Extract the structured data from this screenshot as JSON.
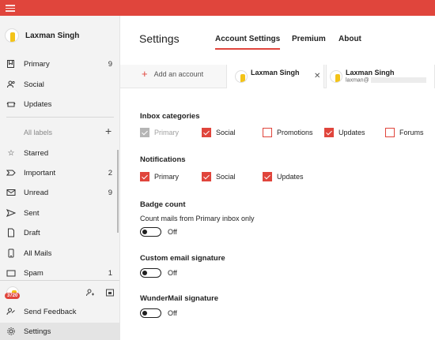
{
  "user": {
    "name": "Laxman Singh"
  },
  "sidebar": {
    "primary": [
      {
        "label": "Primary",
        "count": "9",
        "icon": "inbox-icon"
      },
      {
        "label": "Social",
        "count": "",
        "icon": "people-icon"
      },
      {
        "label": "Updates",
        "count": "",
        "icon": "updates-icon"
      }
    ],
    "all_labels": "All labels",
    "labels": [
      {
        "label": "Starred",
        "count": "",
        "icon": "star-icon"
      },
      {
        "label": "Important",
        "count": "2",
        "icon": "important-icon"
      },
      {
        "label": "Unread",
        "count": "9",
        "icon": "mail-icon"
      },
      {
        "label": "Sent",
        "count": "",
        "icon": "send-icon"
      },
      {
        "label": "Draft",
        "count": "",
        "icon": "draft-icon"
      },
      {
        "label": "All Mails",
        "count": "",
        "icon": "phone-icon"
      },
      {
        "label": "Spam",
        "count": "1",
        "icon": "spam-icon"
      }
    ],
    "badge": "3720",
    "send_feedback": "Send Feedback",
    "settings": "Settings"
  },
  "main": {
    "title": "Settings",
    "tabs": [
      "Account Settings",
      "Premium",
      "About"
    ],
    "active_tab": "Account Settings",
    "add_account": "Add an account",
    "accounts": [
      {
        "name": "Laxman Singh",
        "email": ""
      },
      {
        "name": "Laxman Singh",
        "email": "laxman@"
      }
    ],
    "inbox_categories": {
      "title": "Inbox categories",
      "items": [
        {
          "label": "Primary",
          "checked": true,
          "disabled": true
        },
        {
          "label": "Social",
          "checked": true,
          "disabled": false
        },
        {
          "label": "Promotions",
          "checked": false,
          "disabled": false
        },
        {
          "label": "Updates",
          "checked": true,
          "disabled": false
        },
        {
          "label": "Forums",
          "checked": false,
          "disabled": false
        }
      ]
    },
    "notifications": {
      "title": "Notifications",
      "items": [
        {
          "label": "Primary",
          "checked": true
        },
        {
          "label": "Social",
          "checked": true
        },
        {
          "label": "Updates",
          "checked": true
        }
      ]
    },
    "badge_count": {
      "title": "Badge count",
      "desc": "Count mails from Primary inbox only",
      "state": "Off"
    },
    "custom_signature": {
      "title": "Custom email signature",
      "state": "Off"
    },
    "wundermail_signature": {
      "title": "WunderMail signature",
      "state": "Off"
    }
  },
  "colors": {
    "accent": "#e0453c",
    "sidebar_bg": "#f3f3f3"
  }
}
